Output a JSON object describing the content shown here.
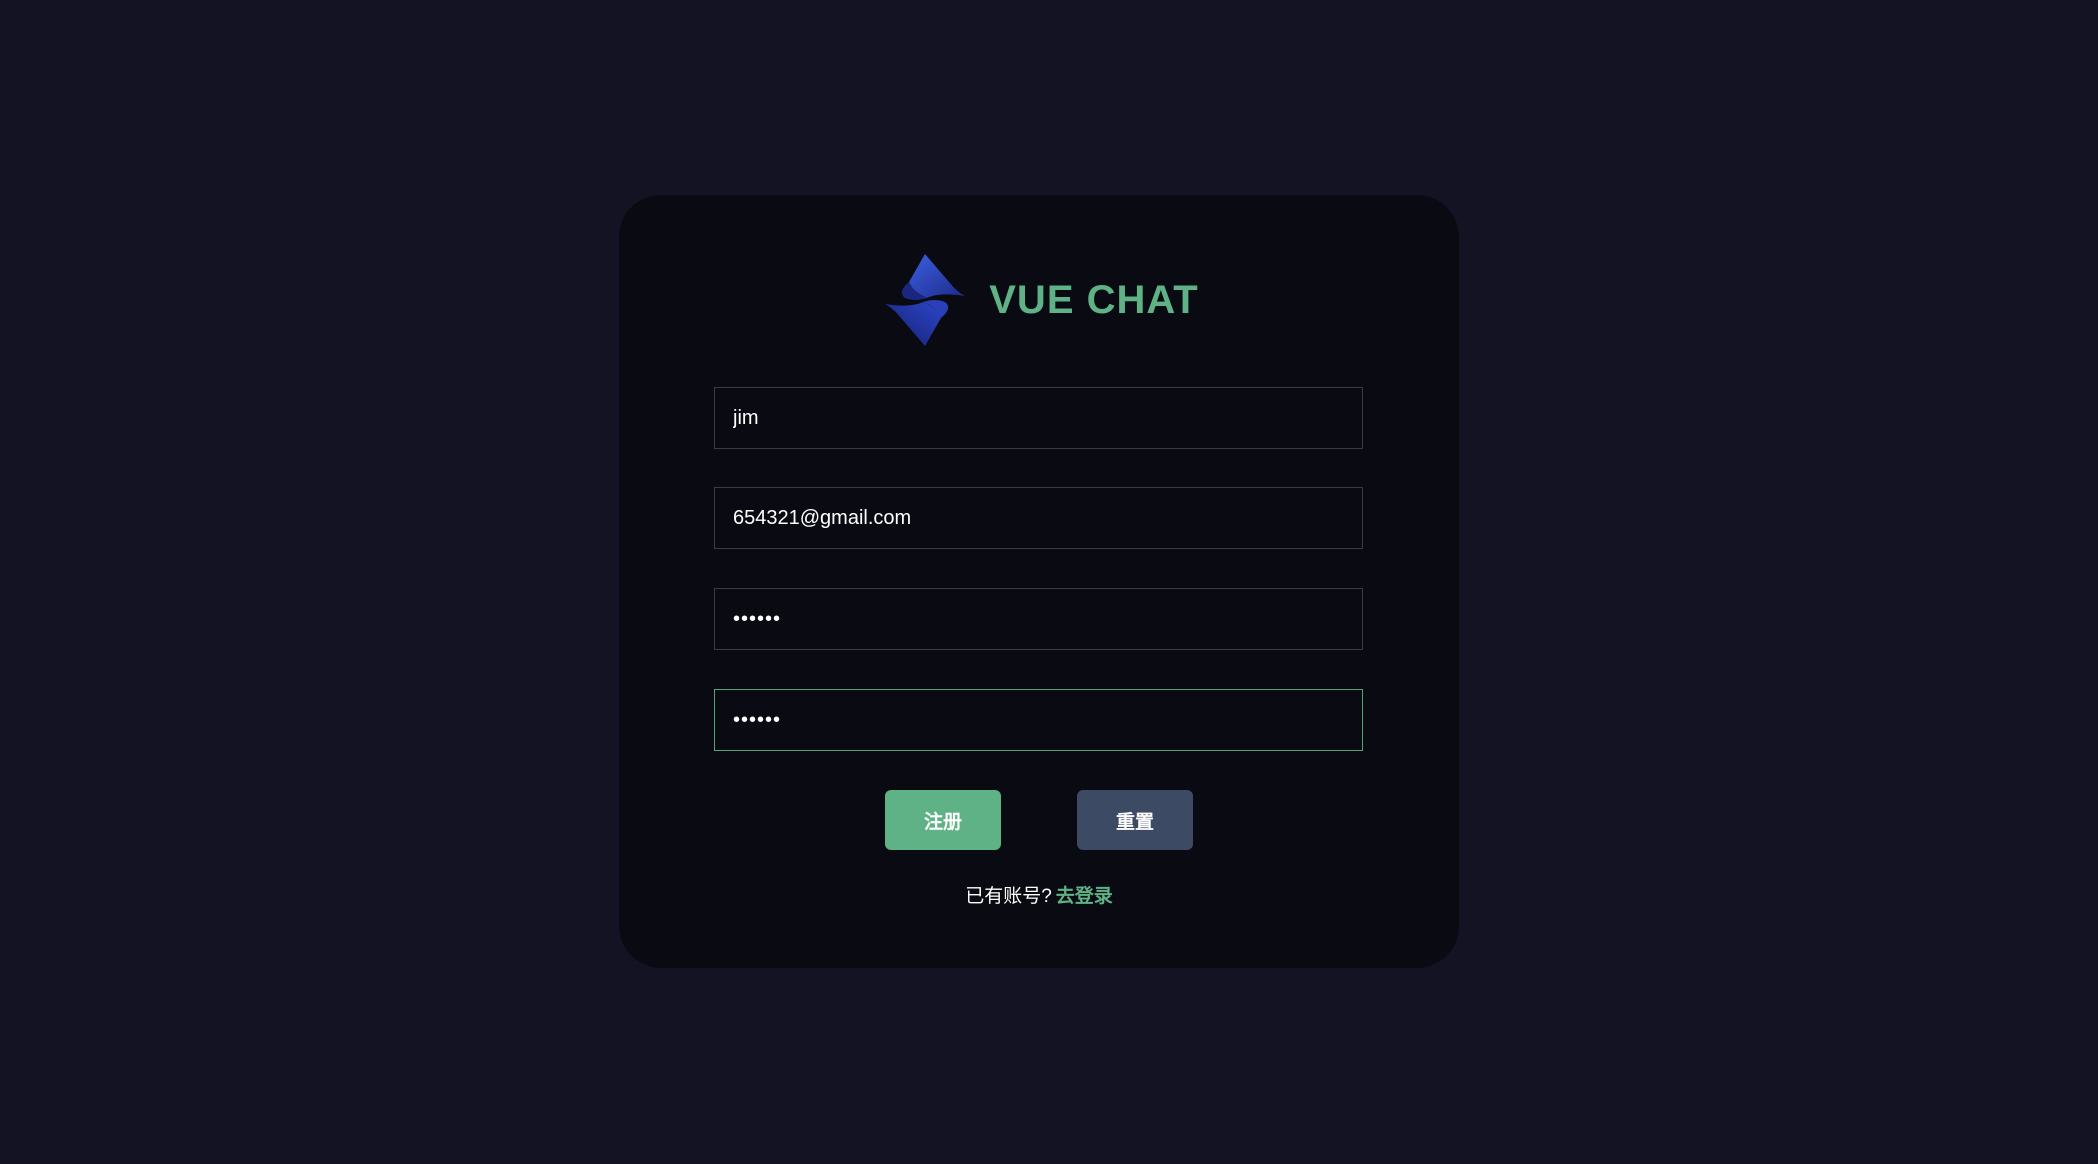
{
  "brand": {
    "title": "VUE CHAT",
    "logo_icon": "blue-s-diamond-logo-icon",
    "title_color": "#5fb285"
  },
  "form": {
    "username": {
      "value": "jim"
    },
    "email": {
      "value": "654321@gmail.com"
    },
    "password": {
      "value": "••••••"
    },
    "confirm_password": {
      "value": "••••••"
    }
  },
  "buttons": {
    "register_label": "注册",
    "reset_label": "重置"
  },
  "footer": {
    "prompt": "已有账号?",
    "login_link": "去登录"
  },
  "colors": {
    "background": "#131324",
    "card": "#0a0a12",
    "accent": "#5fb285",
    "reset_button": "#3c4a63"
  }
}
